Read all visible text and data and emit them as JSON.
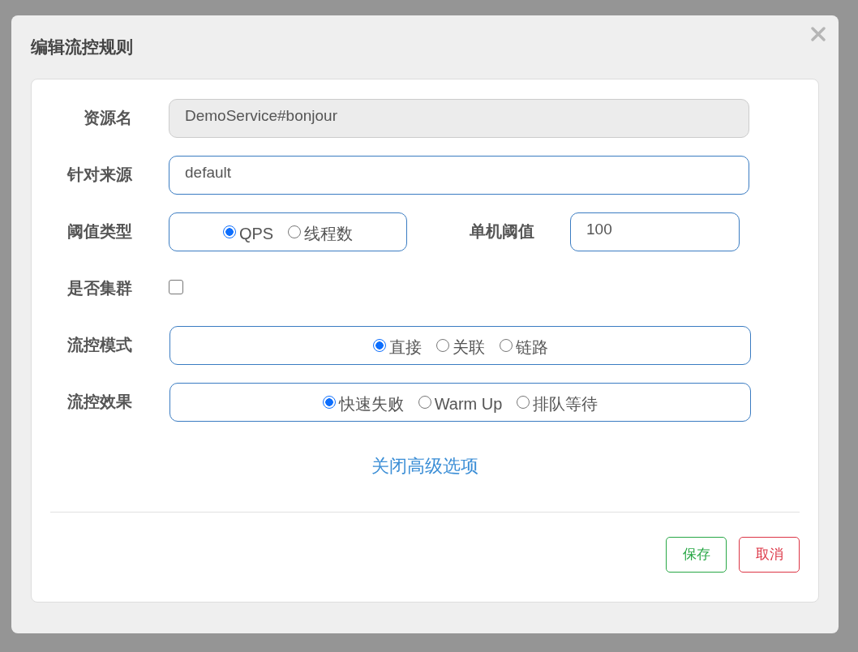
{
  "dialog": {
    "title": "编辑流控规则",
    "fields": [
      {
        "kind": "text",
        "label": "资源名",
        "value": "DemoService#bonjour",
        "disabled": true
      },
      {
        "kind": "text",
        "label": "针对来源",
        "value": "default",
        "disabled": false
      },
      {
        "kind": "radio",
        "label": "阈值类型",
        "options": [
          {
            "label": "QPS",
            "selected": true
          },
          {
            "label": "线程数",
            "selected": false
          }
        ],
        "side": {
          "label": "单机阈值",
          "value": "100"
        }
      },
      {
        "kind": "checkbox",
        "label": "是否集群",
        "checked": false
      },
      {
        "kind": "radio",
        "label": "流控模式",
        "options": [
          {
            "label": "直接",
            "selected": true
          },
          {
            "label": "关联",
            "selected": false
          },
          {
            "label": "链路",
            "selected": false
          }
        ]
      },
      {
        "kind": "radio",
        "label": "流控效果",
        "options": [
          {
            "label": "快速失败",
            "selected": true
          },
          {
            "label": "Warm Up",
            "selected": false
          },
          {
            "label": "排队等待",
            "selected": false
          }
        ]
      }
    ],
    "link": "关闭高级选项",
    "buttons": [
      {
        "kind": "save",
        "label": "保存"
      },
      {
        "kind": "cancel",
        "label": "取消"
      }
    ]
  }
}
